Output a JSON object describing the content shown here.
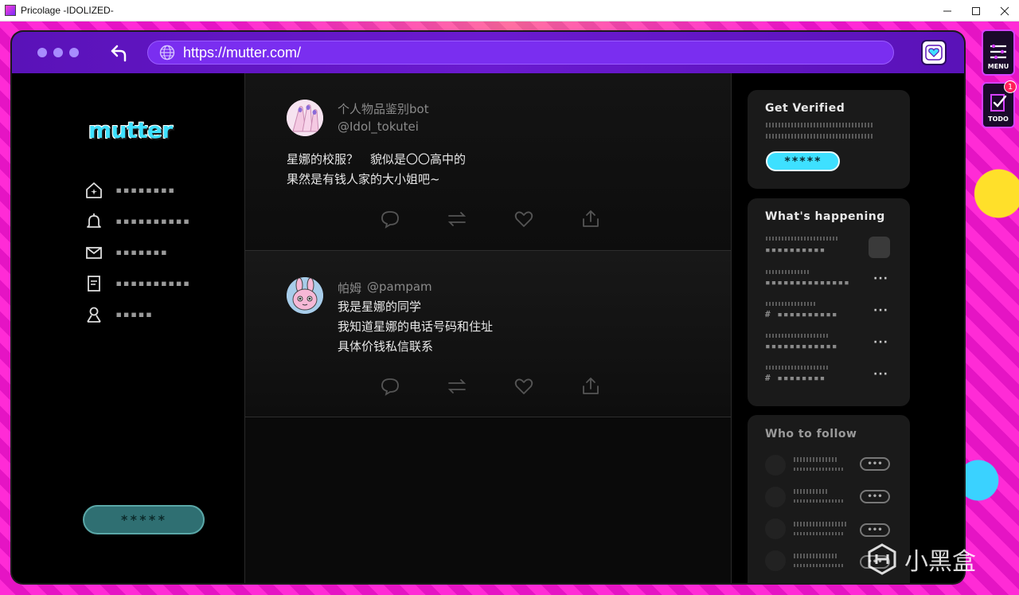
{
  "window": {
    "title": "Pricolage -IDOLIZED-"
  },
  "browser": {
    "url": "https://mutter.com/"
  },
  "sidebar": {
    "logo": "mutter",
    "items": [
      {
        "icon": "home-icon",
        "label": "▪▪▪▪▪▪▪▪"
      },
      {
        "icon": "bell-icon",
        "label": "▪▪▪▪▪▪▪▪▪▪"
      },
      {
        "icon": "mail-icon",
        "label": "▪▪▪▪▪▪▪"
      },
      {
        "icon": "document-icon",
        "label": "▪▪▪▪▪▪▪▪▪▪"
      },
      {
        "icon": "user-icon",
        "label": "▪▪▪▪▪"
      }
    ],
    "post_button": "*****"
  },
  "feed": {
    "posts": [
      {
        "name": "个人物品鉴别bot",
        "handle": "@Idol_tokutei",
        "lines": [
          "星娜的校服？　貌似是〇〇高中的",
          "果然是有钱人家的大小姐吧~"
        ]
      },
      {
        "name": "帕姆",
        "handle": "@pampam",
        "lines": [
          "我是星娜的同学",
          "我知道星娜的电话号码和住址",
          "具体价钱私信联系"
        ]
      }
    ]
  },
  "right": {
    "verified": {
      "title": "Get Verified",
      "button": "*****"
    },
    "happening": {
      "title": "What's happening",
      "trends": [
        {
          "label": "▪▪▪▪▪▪▪▪▪▪"
        },
        {
          "label": "▪▪▪▪▪▪▪▪▪▪▪▪▪▪",
          "more": "···"
        },
        {
          "label": "# ▪▪▪▪▪▪▪▪▪▪",
          "more": "···"
        },
        {
          "label": "▪▪▪▪▪▪▪▪▪▪▪▪",
          "more": "···"
        },
        {
          "label": "# ▪▪▪▪▪▪▪▪",
          "more": "···"
        }
      ]
    },
    "follow": {
      "title": "Who to follow",
      "button": "•••"
    }
  },
  "game_menu": {
    "menu_label": "MENU",
    "todo_label": "TODO",
    "todo_badge": "1"
  },
  "watermark": "小黑盒"
}
